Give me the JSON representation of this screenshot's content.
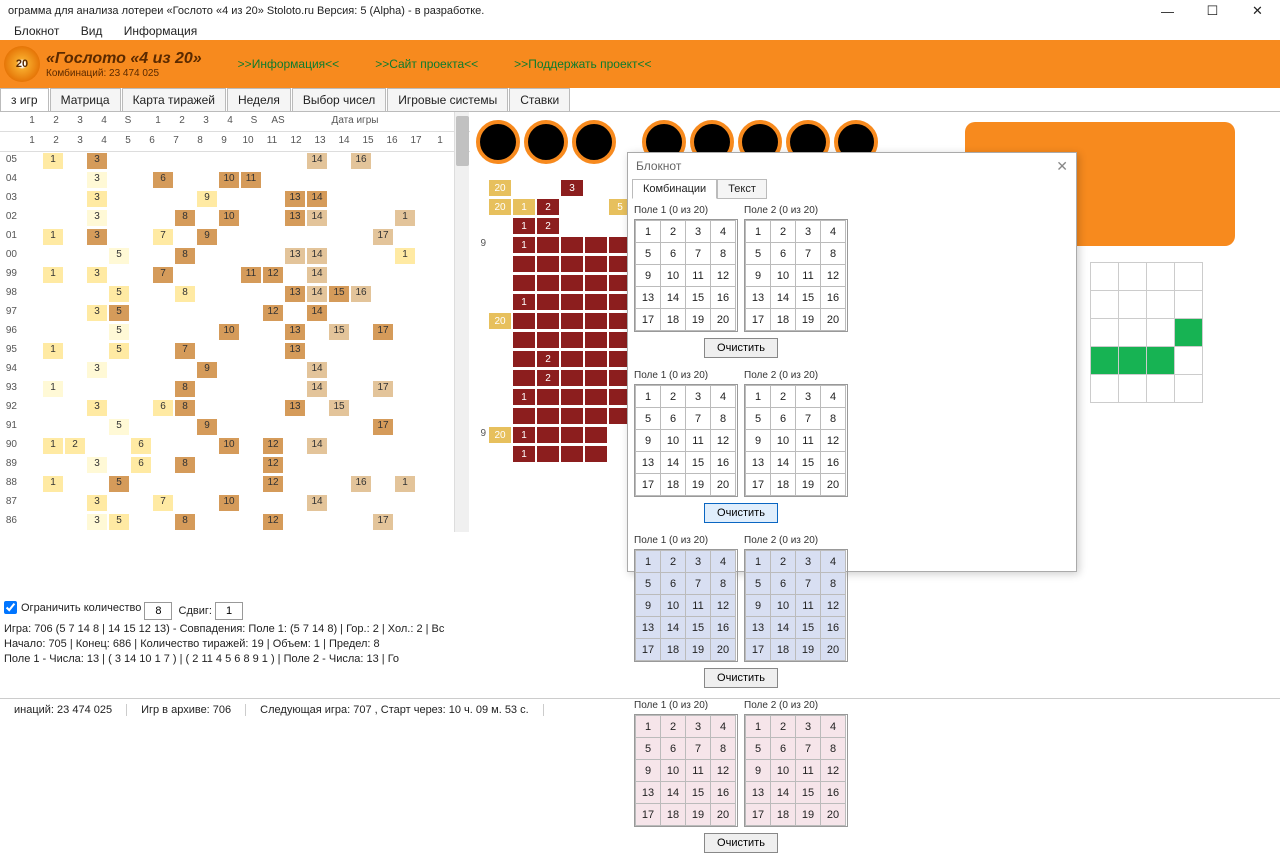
{
  "window": {
    "title": "ограмма для анализа лотереи «Гослото «4 из 20» Stoloto.ru Версия: 5 (Alpha) - в разработке."
  },
  "menu": {
    "items": [
      "Блокнот",
      "Вид",
      "Информация"
    ]
  },
  "header": {
    "title": "«Гослото «4 из 20»",
    "sub": "Комбинаций: 23 474 025",
    "links": [
      ">>Информация<<",
      ">>Сайт проекта<<",
      ">>Поддержать проект<<"
    ]
  },
  "tabs": [
    "з игр",
    "Матрица",
    "Карта тиражей",
    "Неделя",
    "Выбор чисел",
    "Игровые системы",
    "Ставки"
  ],
  "active_tab": 0,
  "grid_header": {
    "groupA": [
      "1",
      "2",
      "3",
      "4",
      "S"
    ],
    "groupB": [
      "1",
      "2",
      "3",
      "4",
      "S",
      "AS"
    ],
    "cols": [
      "1",
      "2",
      "3",
      "4",
      "5",
      "6",
      "7",
      "8",
      "9",
      "10",
      "11",
      "12",
      "13",
      "14",
      "15",
      "16",
      "17",
      "1"
    ],
    "date": "Дата игры"
  },
  "row_nums": [
    "05",
    "04",
    "03",
    "02",
    "01",
    "00",
    "99",
    "98",
    "97",
    "96",
    "95",
    "94",
    "93",
    "92",
    "91",
    "90",
    "89",
    "88",
    "87",
    "86"
  ],
  "footer": {
    "limit_label": "Ограничить количество",
    "limit_value": "8",
    "shift_label": "Сдвиг:",
    "shift_value": "1",
    "line2": "Игра: 706 (5 7 14 8 | 14 15 12 13) - Совпадения: Поле 1: (5 7 14 8) | Гор.: 2 | Хол.: 2 | Вс",
    "line3": "Начало: 705 | Конец: 686 | Количество тиражей: 19 | Объем: 1 | Предел: 8",
    "line4": "Поле 1 - Числа: 13 | ( 3 14 10 1 7 ) | ( 2 11 4 5 6 8 9 1 ) | Поле 2 - Числа: 13 | Го"
  },
  "status": {
    "seg1": "инаций: 23 474 025",
    "seg2": "Игр в архиве: 706",
    "seg3": "Следующая игра: 707 , Старт через: 10 ч. 09 м. 53 с."
  },
  "notepad": {
    "title": "Блокнот",
    "tabs": [
      "Комбинации",
      "Текст"
    ],
    "field_labels": [
      "Поле 1  (0 из 20)",
      "Поле 2  (0 из 20)",
      "Поле 1  (0 из 20)",
      "Поле 2  (0 из 20)",
      "Поле 1  (0 из 20)",
      "Поле 2  (0 из 20)",
      "Поле 1  (0 из 20)",
      "Поле 2  (0 из 20)"
    ],
    "clear": "Очистить",
    "numbers": [
      [
        1,
        2,
        3,
        4
      ],
      [
        5,
        6,
        7,
        8
      ],
      [
        9,
        10,
        11,
        12
      ],
      [
        13,
        14,
        15,
        16
      ],
      [
        17,
        18,
        19,
        20
      ]
    ]
  },
  "mini_grid": {
    "green_cells": [
      [
        2,
        3
      ],
      [
        3,
        0
      ],
      [
        3,
        1
      ],
      [
        3,
        2
      ]
    ]
  },
  "red_matrix_rows": [
    "",
    "",
    "",
    "9",
    "",
    "",
    "",
    "",
    "",
    "",
    "",
    "",
    "",
    "9",
    ""
  ]
}
